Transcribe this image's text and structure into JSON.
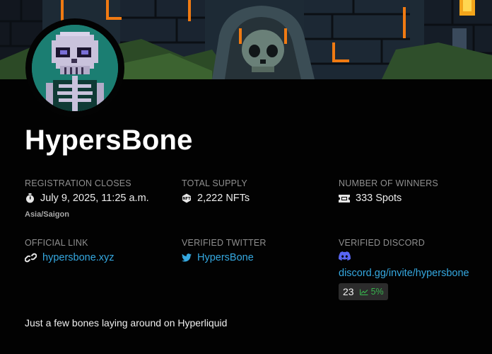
{
  "project": {
    "name": "HypersBone",
    "description": "Just a few bones laying around on Hyperliquid"
  },
  "icons": {
    "banner": "pixel-art-skull-banner",
    "avatar": "pixel-art-skeleton-avatar",
    "registration": "stopwatch-icon",
    "supply": "nft-hexagon-icon",
    "winners": "ticket-icon",
    "link": "link-icon",
    "twitter": "twitter-bird-icon",
    "discord": "discord-icon",
    "trend": "trend-up-icon"
  },
  "colors": {
    "background": "#020202",
    "link": "#35a8e0",
    "discord": "#5865f2",
    "trend_up": "#38b24e",
    "avatar_bg": "#1b7e72"
  },
  "registration": {
    "label": "REGISTRATION CLOSES",
    "value": "July 9, 2025, 11:25 a.m.",
    "timezone": "Asia/Saigon"
  },
  "supply": {
    "label": "TOTAL SUPPLY",
    "value": "2,222 NFTs"
  },
  "winners": {
    "label": "NUMBER OF WINNERS",
    "value": "333 Spots"
  },
  "official_link": {
    "label": "OFFICIAL LINK",
    "value": "hypersbone.xyz"
  },
  "twitter": {
    "label": "VERIFIED TWITTER",
    "value": "HypersBone"
  },
  "discord": {
    "label": "VERIFIED DISCORD",
    "value": "discord.gg/invite/hypersbone",
    "members": "23",
    "growth": "5%"
  }
}
